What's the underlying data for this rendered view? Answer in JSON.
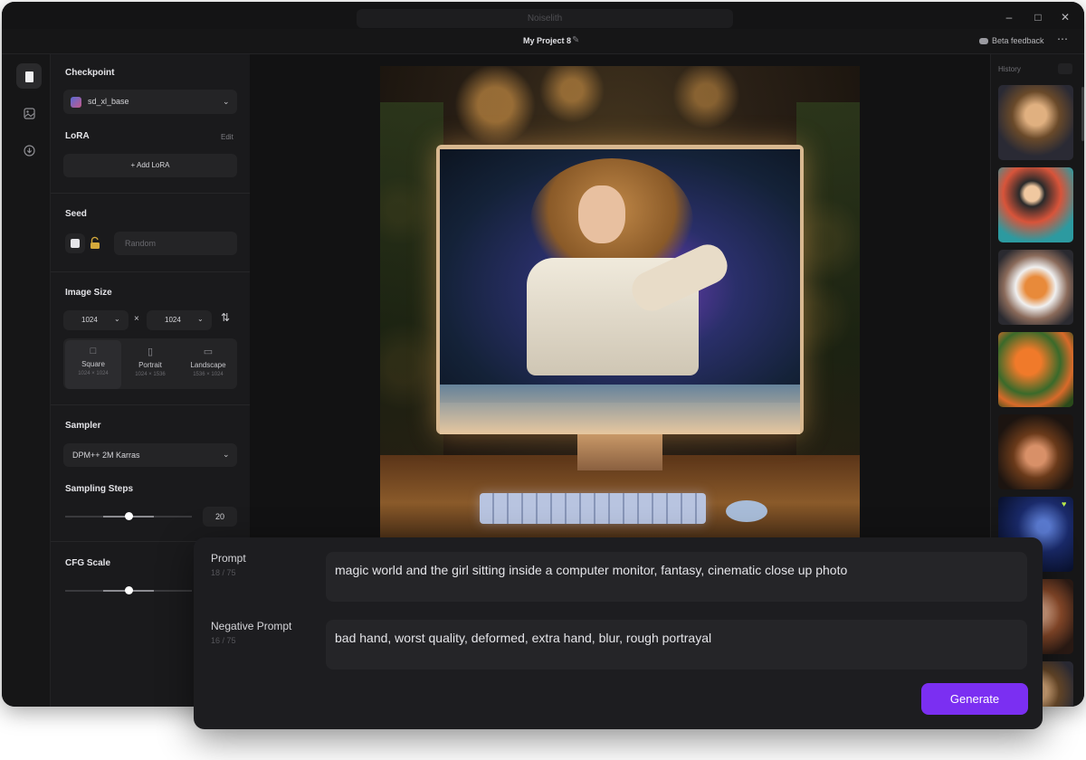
{
  "app": {
    "title": "Noiselith",
    "project_name": "My Project 8",
    "beta_feedback": "Beta feedback",
    "window_controls": [
      "minimize-icon",
      "maximize-icon",
      "close-icon"
    ]
  },
  "rail": {
    "items": [
      {
        "icon": "document-icon",
        "active": true
      },
      {
        "icon": "image-icon",
        "active": false
      },
      {
        "icon": "download-icon",
        "active": false
      }
    ]
  },
  "settings": {
    "checkpoint": {
      "label": "Checkpoint",
      "value": "sd_xl_base"
    },
    "lora": {
      "label": "LoRA",
      "edit": "Edit",
      "add": "+ Add LoRA"
    },
    "seed": {
      "label": "Seed",
      "placeholder": "Random"
    },
    "image_size": {
      "label": "Image Size",
      "width": "1024",
      "height": "1024",
      "times": "×",
      "presets": [
        {
          "name": "Square",
          "size": "1024 × 1024",
          "icon": "square-icon"
        },
        {
          "name": "Portrait",
          "size": "1024 × 1536",
          "icon": "portrait-icon"
        },
        {
          "name": "Landscape",
          "size": "1536 × 1024",
          "icon": "landscape-icon"
        }
      ]
    },
    "sampler": {
      "label": "Sampler",
      "value": "DPM++ 2M Karras"
    },
    "sampling_steps": {
      "label": "Sampling Steps",
      "value": "20",
      "fraction": 0.5
    },
    "cfg_scale": {
      "label": "CFG Scale",
      "fraction": 0.5
    }
  },
  "history": {
    "label": "History",
    "items": [
      {
        "subject": "girl in computer monitor"
      },
      {
        "subject": "retro woman poster"
      },
      {
        "subject": "tiger astronaut"
      },
      {
        "subject": "orange flowers"
      },
      {
        "subject": "curly haired boy portrait"
      },
      {
        "subject": "galaxy sky",
        "favorite": true
      },
      {
        "subject": "woman portrait"
      },
      {
        "subject": "girl in computer monitor"
      }
    ]
  },
  "prompt": {
    "label": "Prompt",
    "count": "18 / 75",
    "text": "magic world and the girl sitting inside a computer monitor, fantasy, cinematic close up photo"
  },
  "negative_prompt": {
    "label": "Negative Prompt",
    "count": "16 / 75",
    "text": "bad hand, worst quality, deformed, extra hand, blur, rough portrayal"
  },
  "generate": {
    "label": "Generate"
  },
  "colors": {
    "accent": "#7b2ff2",
    "background": "#161617",
    "panel": "#1a1a1c"
  }
}
